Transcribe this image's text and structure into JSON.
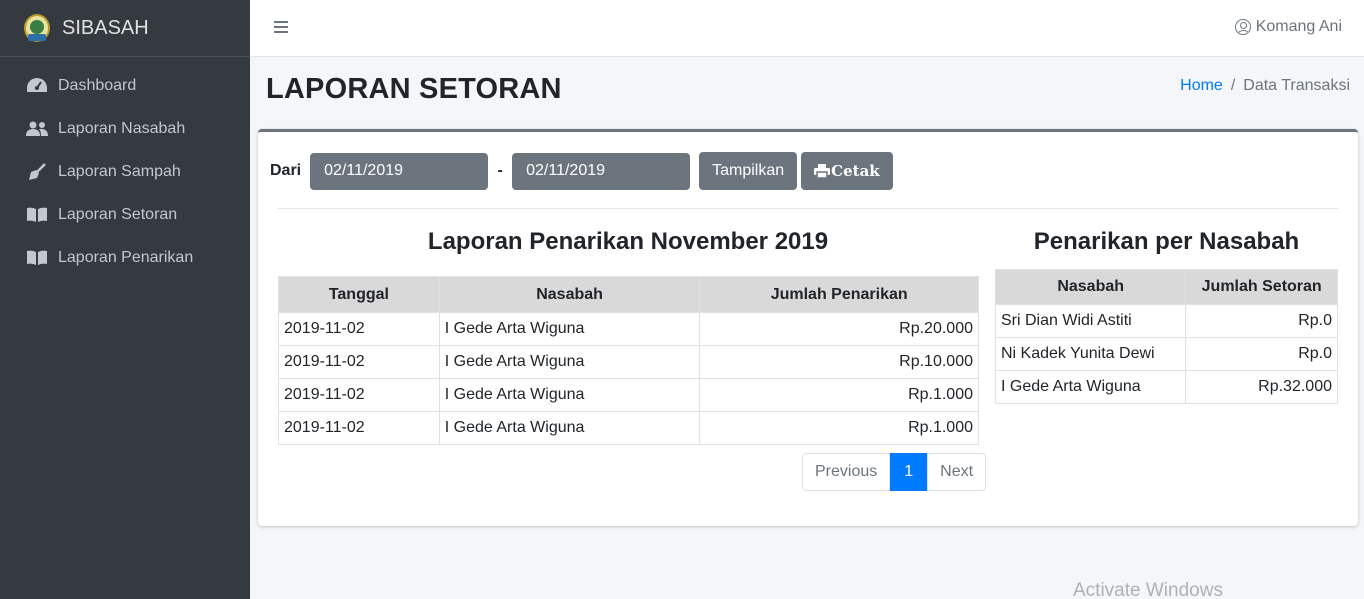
{
  "app": {
    "name": "SIBASAH"
  },
  "sidebar": {
    "items": [
      {
        "label": "Dashboard",
        "icon": "tachometer-icon"
      },
      {
        "label": "Laporan Nasabah",
        "icon": "users-icon"
      },
      {
        "label": "Laporan Sampah",
        "icon": "broom-icon"
      },
      {
        "label": "Laporan Setoran",
        "icon": "book-icon"
      },
      {
        "label": "Laporan Penarikan",
        "icon": "book-icon"
      }
    ]
  },
  "topbar": {
    "user_name": "Komang Ani"
  },
  "header": {
    "title": "LAPORAN SETORAN",
    "breadcrumb": {
      "home": "Home",
      "separator": "/",
      "current": "Data Transaksi"
    }
  },
  "filter": {
    "label": "Dari",
    "date_from": "02/11/2019",
    "separator": "-",
    "date_to": "02/11/2019",
    "show_button": "Tampilkan",
    "print_button": "Cetak"
  },
  "left_report": {
    "title": "Laporan Penarikan November 2019",
    "columns": [
      "Tanggal",
      "Nasabah",
      "Jumlah Penarikan"
    ],
    "rows": [
      [
        "2019-11-02",
        "I Gede Arta Wiguna",
        "Rp.20.000"
      ],
      [
        "2019-11-02",
        "I Gede Arta Wiguna",
        "Rp.10.000"
      ],
      [
        "2019-11-02",
        "I Gede Arta Wiguna",
        "Rp.1.000"
      ],
      [
        "2019-11-02",
        "I Gede Arta Wiguna",
        "Rp.1.000"
      ]
    ]
  },
  "pagination": {
    "previous": "Previous",
    "current": "1",
    "next": "Next"
  },
  "right_report": {
    "title": "Penarikan per Nasabah",
    "columns": [
      "Nasabah",
      "Jumlah Setoran"
    ],
    "rows": [
      [
        "Sri Dian Widi Astiti",
        "Rp.0"
      ],
      [
        "Ni Kadek Yunita Dewi",
        "Rp.0"
      ],
      [
        "I Gede Arta Wiguna",
        "Rp.32.000"
      ]
    ]
  },
  "watermark": "Activate Windows",
  "colors": {
    "sidebar_bg": "#343a40",
    "primary": "#007bff",
    "secondary": "#6c757d"
  }
}
